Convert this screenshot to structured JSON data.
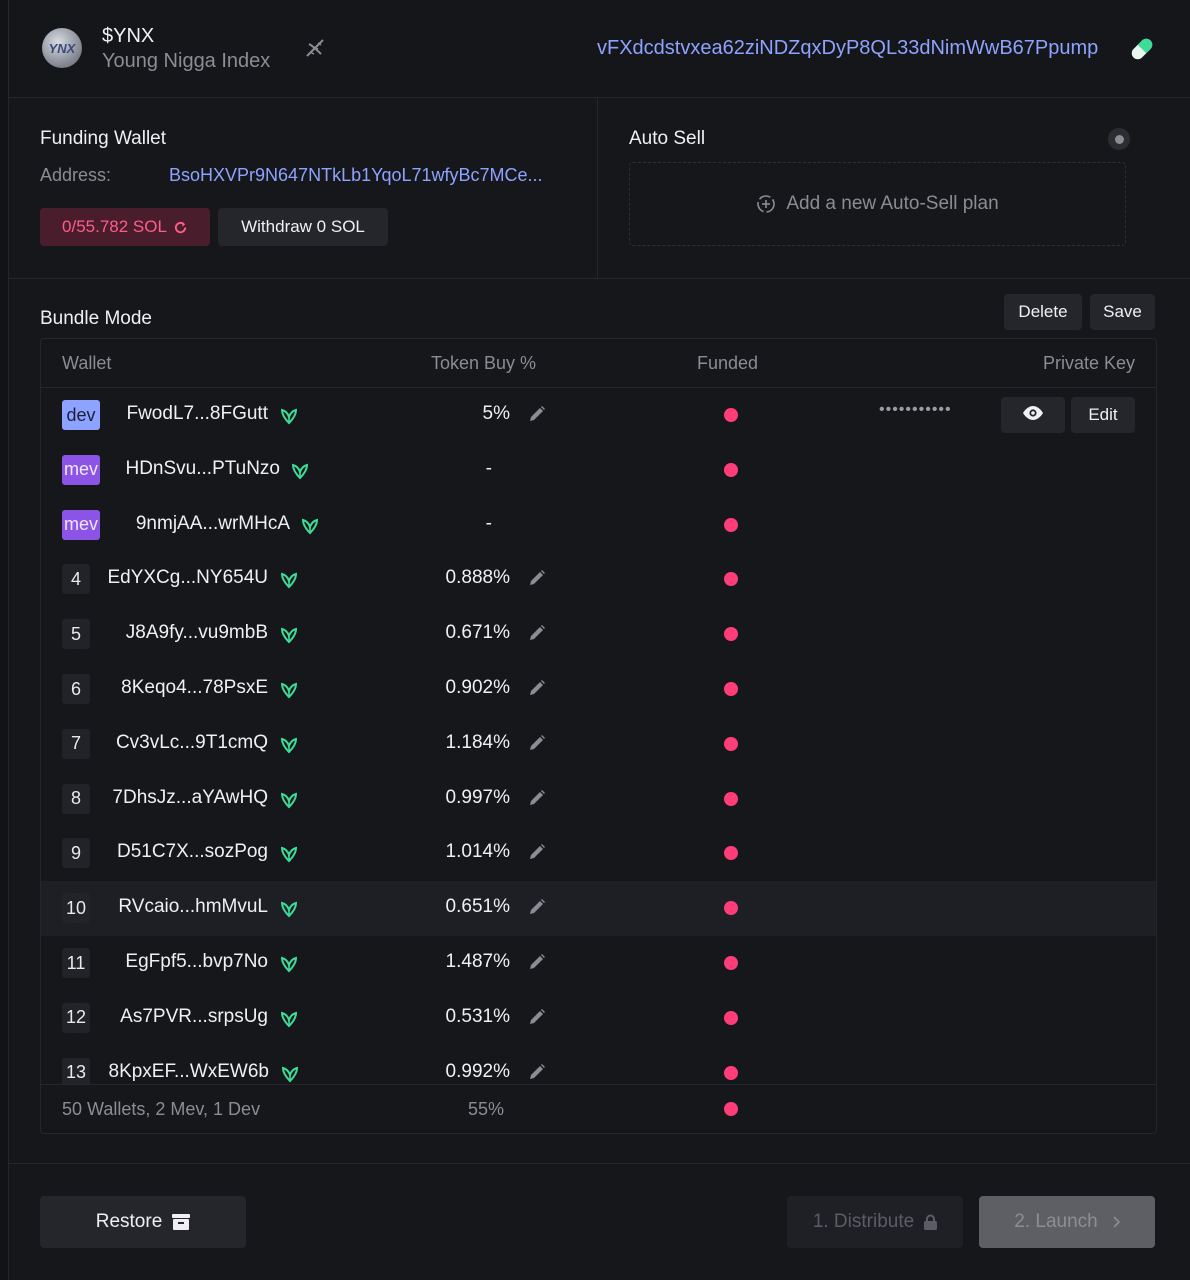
{
  "header": {
    "ticker": "$YNX",
    "token_name": "Young Nigga Index",
    "logo_text": "YNX",
    "contract_address": "vFXdcdstvxea62ziNDZqxDyP8QL33dNimWwB67Ppump"
  },
  "funding": {
    "title": "Funding Wallet",
    "address_label": "Address:",
    "address_value": "BsoHXVPr9N647NTkLb1YqoL71wfyBc7MCe...",
    "balance_label": "0/55.782 SOL",
    "withdraw_label": "Withdraw 0 SOL"
  },
  "auto_sell": {
    "title": "Auto Sell",
    "add_plan_label": "Add a new Auto-Sell plan"
  },
  "bundle": {
    "title": "Bundle Mode",
    "delete_label": "Delete",
    "save_label": "Save",
    "columns": {
      "wallet": "Wallet",
      "token_buy": "Token Buy %",
      "funded": "Funded",
      "private_key": "Private Key"
    },
    "dev_row": {
      "tag": "dev",
      "wallet": "FwodL7...8FGutt",
      "pct": "5%",
      "private_key_masked": "•••••••••••",
      "edit_label": "Edit"
    },
    "mev_rows": [
      {
        "tag": "mev",
        "wallet": "HDnSvu...PTuNzo",
        "pct": "-"
      },
      {
        "tag": "mev",
        "wallet": "9nmjAA...wrMHcA",
        "pct": "-"
      }
    ],
    "rows": [
      {
        "num": "4",
        "wallet": "EdYXCg...NY654U",
        "pct": "0.888%"
      },
      {
        "num": "5",
        "wallet": "J8A9fy...vu9mbB",
        "pct": "0.671%"
      },
      {
        "num": "6",
        "wallet": "8Keqo4...78PsxE",
        "pct": "0.902%"
      },
      {
        "num": "7",
        "wallet": "Cv3vLc...9T1cmQ",
        "pct": "1.184%"
      },
      {
        "num": "8",
        "wallet": "7DhsJz...aYAwHQ",
        "pct": "0.997%"
      },
      {
        "num": "9",
        "wallet": "D51C7X...sozPog",
        "pct": "1.014%"
      },
      {
        "num": "10",
        "wallet": "RVcaio...hmMvuL",
        "pct": "0.651%"
      },
      {
        "num": "11",
        "wallet": "EgFpf5...bvp7No",
        "pct": "1.487%"
      },
      {
        "num": "12",
        "wallet": "As7PVR...srpsUg",
        "pct": "0.531%"
      },
      {
        "num": "13",
        "wallet": "8KpxEF...WxEW6b",
        "pct": "0.992%"
      }
    ],
    "summary": "50 Wallets, 2 Mev, 1 Dev",
    "total_pct": "55%"
  },
  "footer": {
    "restore_label": "Restore",
    "distribute_label": "1. Distribute",
    "launch_label": "2. Launch"
  },
  "colors": {
    "accent": "#8ea2ff",
    "funded_dot": "#ff3d78",
    "mev_tag": "#8b54e6",
    "dev_tag": "#8ea2ff",
    "leaf": "#3ddc97"
  },
  "icons": {
    "logo": "token-logo",
    "dna": "dna-icon",
    "pill": "pill-icon",
    "refresh": "refresh-icon",
    "add_plan": "add-circle-icon",
    "wallet_badge": "leaf-icon",
    "edit": "pencil-icon",
    "visibility": "eye-icon",
    "restore": "archive-icon",
    "locked": "lock-icon",
    "next": "chevron-right-icon"
  }
}
